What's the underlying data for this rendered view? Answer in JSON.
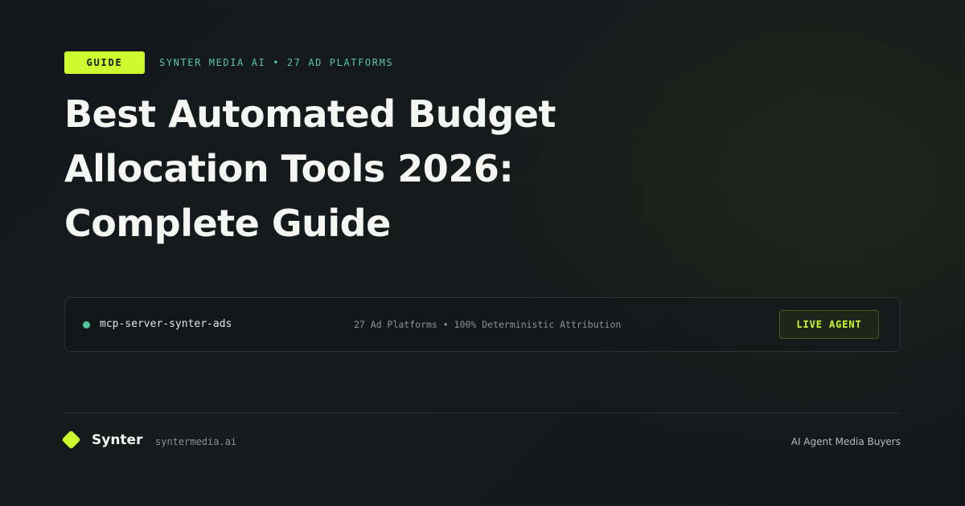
{
  "header": {
    "badge_label": "GUIDE",
    "kicker": "SYNTER MEDIA AI • 27 AD PLATFORMS"
  },
  "title": {
    "lines": [
      "Best Automated Budget",
      "Allocation Tools 2026:",
      "Complete Guide"
    ]
  },
  "status_panel": {
    "server_name": "mcp-server-synter-ads",
    "stats": "27 Ad Platforms • 100% Deterministic Attribution",
    "button_label": "LIVE AGENT"
  },
  "footer": {
    "brand_name": "Synter",
    "brand_url": "syntermedia.ai",
    "tagline": "AI Agent Media Buyers"
  },
  "colors": {
    "accent": "#cbfb2e",
    "status_green": "#52c69d",
    "background": "#13171b",
    "title_text": "#f5f5f2"
  },
  "icons": {
    "status_indicator": "status-dot-icon",
    "brand_mark": "diamond-logo-icon"
  }
}
